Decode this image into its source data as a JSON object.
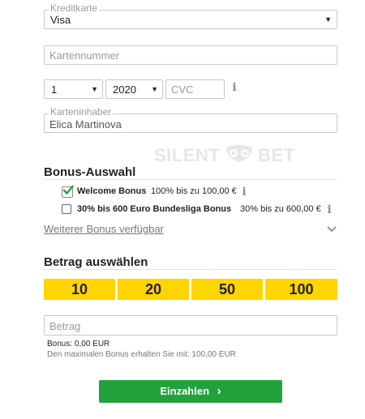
{
  "payment": {
    "card_type_legend": "Kreditkarte",
    "card_type_value": "Visa",
    "card_number_placeholder": "Kartennummer",
    "month_value": "1",
    "year_value": "2020",
    "cvc_placeholder": "CVC",
    "holder_legend": "Karteninhaber",
    "holder_value": "Elica Martinova"
  },
  "watermark": {
    "left": "SILENT",
    "right": "BET"
  },
  "bonus": {
    "title": "Bonus-Auswahl",
    "options": [
      {
        "name": "Welcome Bonus",
        "desc": "100% bis zu 100,00 €",
        "checked": true
      },
      {
        "name": "30% bis 600 Euro Bundesliga Bonus",
        "desc": "30% bis zu 600,00 €",
        "checked": false
      }
    ],
    "more_link": "Weiterer Bonus verfügbar"
  },
  "amount": {
    "title": "Betrag auswählen",
    "presets": [
      "10",
      "20",
      "50",
      "100"
    ],
    "input_placeholder": "Betrag",
    "bonus_line": "Bonus: 0,00 EUR",
    "max_line": "Den maximalen Bonus erhalten Sie mit: 100,00 EUR"
  },
  "cta": {
    "label": "Einzahlen",
    "arrow": "›"
  },
  "icons": {
    "info": "info-icon",
    "caret": "caret-down-icon",
    "chevron": "chevron-down-icon",
    "check": "checkmark-icon",
    "owl": "owl-logo-icon"
  },
  "colors": {
    "accent_yellow": "#ffd400",
    "accent_green": "#23a23c",
    "check_green": "#23a23c"
  }
}
